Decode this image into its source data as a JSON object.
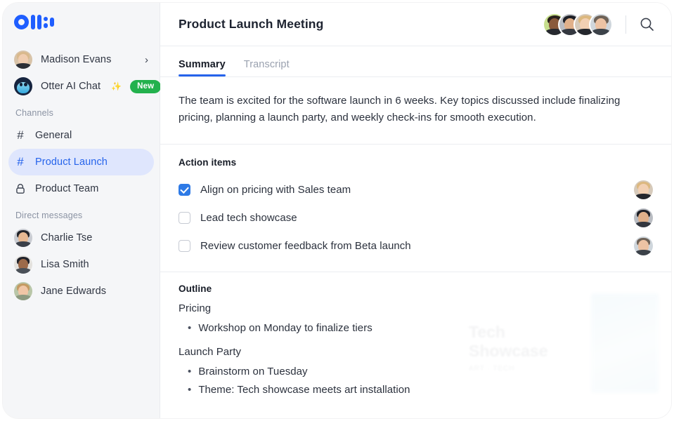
{
  "app": {
    "logo_name": "otter-logo"
  },
  "sidebar": {
    "user": {
      "name": "Madison Evans",
      "chevron": "›"
    },
    "ai_chat": {
      "label": "Otter AI Chat",
      "sparkle": "✨",
      "badge": "New"
    },
    "channels_header": "Channels",
    "channels": [
      {
        "icon": "#",
        "label": "General",
        "active": false,
        "private": false
      },
      {
        "icon": "#",
        "label": "Product Launch",
        "active": true,
        "private": false
      },
      {
        "icon": "lock",
        "label": "Product Team",
        "active": false,
        "private": true
      }
    ],
    "dm_header": "Direct messages",
    "direct_messages": [
      {
        "name": "Charlie Tse"
      },
      {
        "name": "Lisa Smith"
      },
      {
        "name": "Jane Edwards"
      }
    ]
  },
  "header": {
    "title": "Product Launch Meeting",
    "participant_count": 4,
    "search_icon": "search-icon"
  },
  "tabs": [
    {
      "label": "Summary",
      "active": true
    },
    {
      "label": "Transcript",
      "active": false
    }
  ],
  "summary": {
    "text": "The team is excited for the software launch in 6 weeks. Key topics discussed include finalizing pricing, planning a launch party, and weekly check-ins for smooth execution."
  },
  "action_items": {
    "heading": "Action items",
    "items": [
      {
        "label": "Align on pricing with Sales team",
        "checked": true
      },
      {
        "label": "Lead tech showcase",
        "checked": false
      },
      {
        "label": "Review customer feedback from Beta launch",
        "checked": false
      }
    ]
  },
  "outline": {
    "heading": "Outline",
    "groups": [
      {
        "topic": "Pricing",
        "bullets": [
          "Workshop on Monday to finalize tiers"
        ]
      },
      {
        "topic": "Launch Party",
        "bullets": [
          "Brainstorm on Tuesday",
          "Theme: Tech showcase meets art installation"
        ]
      }
    ],
    "bullet_glyph": "•"
  },
  "ghost_card": {
    "title": "Tech Showcase",
    "subtitle": "ART  ·  TECH"
  },
  "colors": {
    "brand_blue": "#1f5eff",
    "accent_blue": "#2563eb",
    "checkbox_blue": "#2e7ae6",
    "badge_green": "#23b14d",
    "sidebar_bg": "#f5f6f8",
    "active_row_bg": "#dfe6fd",
    "text_primary": "#2b313d",
    "text_muted": "#9aa1af"
  }
}
